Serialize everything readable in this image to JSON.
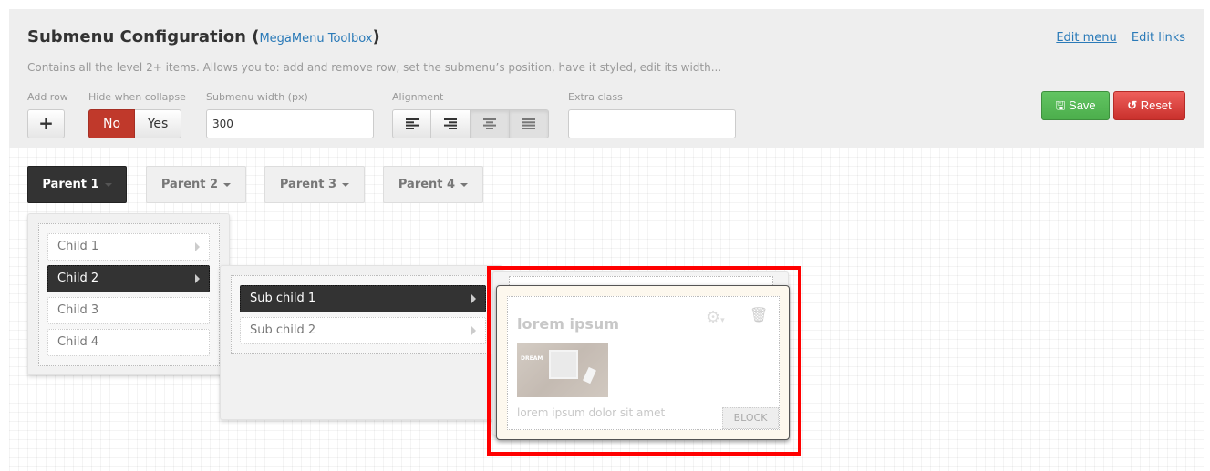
{
  "header": {
    "title": "Submenu Configuration",
    "title_open_paren": "(",
    "title_close_paren": ")",
    "title_link": "MegaMenu Toolbox",
    "description": "Contains all the level 2+ items. Allows you to: add and remove row, set the submenu’s position, have it styled, edit its width...",
    "links": {
      "edit_menu": "Edit menu",
      "edit_links": "Edit links"
    }
  },
  "fields": {
    "add_row": {
      "label": "Add row",
      "button": "+"
    },
    "hide_when_collapse": {
      "label": "Hide when collapse",
      "options": [
        "No",
        "Yes"
      ],
      "selected": "No"
    },
    "submenu_width": {
      "label": "Submenu width (px)",
      "value": "300"
    },
    "alignment": {
      "label": "Alignment",
      "options": [
        "left",
        "right",
        "center",
        "justify"
      ],
      "selected": [
        "left",
        "right"
      ]
    },
    "extra_class": {
      "label": "Extra class",
      "value": ""
    }
  },
  "actions": {
    "save": "Save",
    "reset": "Reset"
  },
  "colors": {
    "accent_link": "#2a7ab8",
    "danger": "#c0392b",
    "success": "#5cb85c",
    "highlight": "#ff0000"
  },
  "menu": {
    "parents": [
      "Parent 1",
      "Parent 2",
      "Parent 3",
      "Parent 4"
    ],
    "active_parent": "Parent 1",
    "children": [
      "Child 1",
      "Child 2",
      "Child 3",
      "Child 4"
    ],
    "active_child": "Child 2",
    "sub_children": [
      "Sub child 1",
      "Sub child 2"
    ],
    "active_sub_child": "Sub child 1"
  },
  "block": {
    "title": "lorem ipsum",
    "description": "lorem ipsum dolor sit amet",
    "badge": "BLOCK",
    "image_text": "DREAM"
  }
}
